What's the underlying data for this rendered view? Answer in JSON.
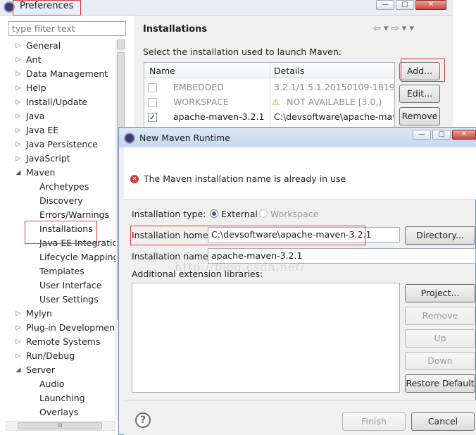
{
  "prefs": {
    "title": "Preferences",
    "filter_placeholder": "type filter text",
    "tree": [
      {
        "label": "General",
        "arrow": "▷",
        "level": 0
      },
      {
        "label": "Ant",
        "arrow": "▷",
        "level": 0
      },
      {
        "label": "Data Management",
        "arrow": "▷",
        "level": 0
      },
      {
        "label": "Help",
        "arrow": "▷",
        "level": 0
      },
      {
        "label": "Install/Update",
        "arrow": "▷",
        "level": 0
      },
      {
        "label": "Java",
        "arrow": "▷",
        "level": 0
      },
      {
        "label": "Java EE",
        "arrow": "▷",
        "level": 0
      },
      {
        "label": "Java Persistence",
        "arrow": "▷",
        "level": 0
      },
      {
        "label": "JavaScript",
        "arrow": "▷",
        "level": 0
      },
      {
        "label": "Maven",
        "arrow": "◢",
        "level": 0
      },
      {
        "label": "Archetypes",
        "arrow": "",
        "level": 1
      },
      {
        "label": "Discovery",
        "arrow": "",
        "level": 1
      },
      {
        "label": "Errors/Warnings",
        "arrow": "",
        "level": 1
      },
      {
        "label": "Installations",
        "arrow": "",
        "level": 1
      },
      {
        "label": "Java EE Integratio",
        "arrow": "",
        "level": 1
      },
      {
        "label": "Lifecycle Mapping",
        "arrow": "",
        "level": 1
      },
      {
        "label": "Templates",
        "arrow": "",
        "level": 1
      },
      {
        "label": "User Interface",
        "arrow": "",
        "level": 1
      },
      {
        "label": "User Settings",
        "arrow": "",
        "level": 1
      },
      {
        "label": "Mylyn",
        "arrow": "▷",
        "level": 0
      },
      {
        "label": "Plug-in Development",
        "arrow": "▷",
        "level": 0
      },
      {
        "label": "Remote Systems",
        "arrow": "▷",
        "level": 0
      },
      {
        "label": "Run/Debug",
        "arrow": "▷",
        "level": 0
      },
      {
        "label": "Server",
        "arrow": "◢",
        "level": 0
      },
      {
        "label": "Audio",
        "arrow": "",
        "level": 1
      },
      {
        "label": "Launching",
        "arrow": "",
        "level": 1
      },
      {
        "label": "Overlays",
        "arrow": "",
        "level": 1
      }
    ],
    "hscroll_grip": "III",
    "page_title": "Installations",
    "nav_icons": "⇦ ▾ ⇨ ▾ ▾",
    "description": "Select the installation used to launch Maven:",
    "table": {
      "col_name": "Name",
      "col_details": "Details",
      "rows": [
        {
          "checked": false,
          "checkmark": "",
          "name": "EMBEDDED",
          "details": "3.2.1/1.5.1.20150109-1819",
          "warning": "",
          "gray": true
        },
        {
          "checked": false,
          "checkmark": "",
          "name": "WORKSPACE",
          "details": "NOT AVAILABLE [3.0,)",
          "warning": "⚠",
          "gray": true
        },
        {
          "checked": true,
          "checkmark": "✓",
          "name": "apache-maven-3.2.1",
          "details": "C:\\devsoftware\\apache-mave",
          "warning": "",
          "gray": false
        }
      ]
    },
    "buttons": {
      "add": "Add...",
      "edit": "Edit...",
      "remove": "Remove"
    }
  },
  "dialog": {
    "title": "New Maven Runtime",
    "error_message": "The Maven installation name is already in use",
    "error_glyph": "✕",
    "type_label": "Installation type:",
    "type_external": "External",
    "type_workspace": "Workspace",
    "home_label": "Installation home:",
    "home_value": "C:\\devsoftware\\apache-maven-3.2.1",
    "directory_button": "Directory...",
    "name_label": "Installation name:",
    "name_value": "apache-maven-3.2.1",
    "ext_label": "Additional extension libraries:",
    "buttons": {
      "project": "Project...",
      "remove": "Remove",
      "up": "Up",
      "down": "Down",
      "restore": "Restore Default"
    },
    "help_glyph": "?",
    "finish": "Finish",
    "cancel": "Cancel"
  },
  "watermark": "http://blog.csdn.net/",
  "icons": {
    "minimize": "—",
    "maximize": "▢",
    "close": "✕"
  },
  "colors": {
    "highlight_box": "#e03a3a",
    "close_button": "#c9463d",
    "error": "#d23c3c"
  }
}
